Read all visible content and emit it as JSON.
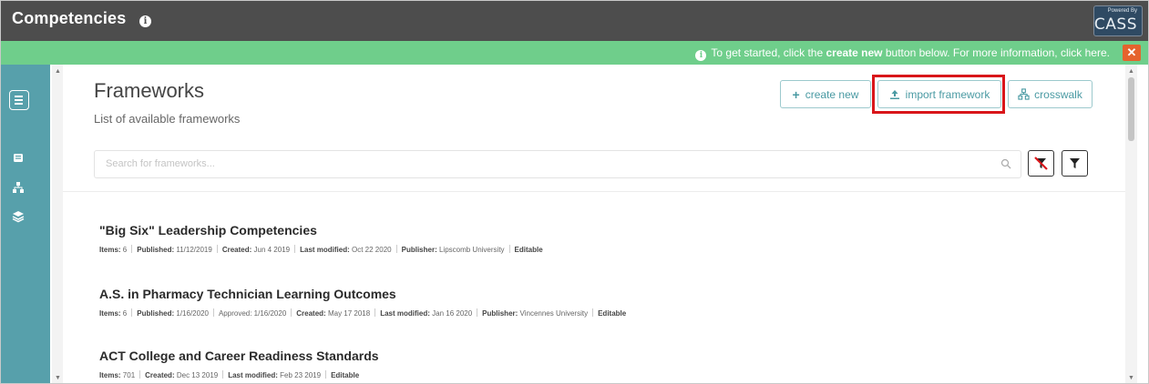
{
  "header": {
    "title": "Competencies",
    "brand_small": "Powered By",
    "brand_name": "CASS"
  },
  "notice": {
    "prefix": "To get started, click the",
    "highlight": "create new",
    "suffix": "button below. For more information, click here.",
    "close_label": "✕"
  },
  "page": {
    "title": "Frameworks",
    "subtitle": "List of available frameworks"
  },
  "toolbar": {
    "create_label": "create new",
    "import_label": "import framework",
    "crosswalk_label": "crosswalk"
  },
  "search": {
    "placeholder": "Search for frameworks..."
  },
  "frameworks": [
    {
      "title": "\"Big Six\" Leadership Competencies",
      "items": "6",
      "published": "11/12/2019",
      "created": "Jun 4 2019",
      "last_modified": "Oct 22 2020",
      "publisher": "Lipscomb University",
      "editable": "Editable"
    },
    {
      "title": "A.S. in Pharmacy Technician Learning Outcomes",
      "items": "6",
      "published": "1/16/2020",
      "approved": "1/16/2020",
      "created": "May 17 2018",
      "last_modified": "Jan 16 2020",
      "publisher": "Vincennes University",
      "editable": "Editable"
    },
    {
      "title": "ACT College and Career Readiness Standards",
      "items": "701",
      "created": "Dec 13 2019",
      "last_modified": "Feb 23 2019",
      "editable": "Editable"
    }
  ],
  "labels": {
    "items": "Items:",
    "published": "Published:",
    "approved": "Approved:",
    "created": "Created:",
    "last_modified": "Last modified:",
    "publisher": "Publisher:"
  },
  "colors": {
    "topbar": "#4d4d4d",
    "notice": "#6fce8b",
    "rail": "#57a0ab",
    "accent": "#4a9aa3",
    "highlight_box": "#d9161a",
    "close": "#e5632d"
  }
}
